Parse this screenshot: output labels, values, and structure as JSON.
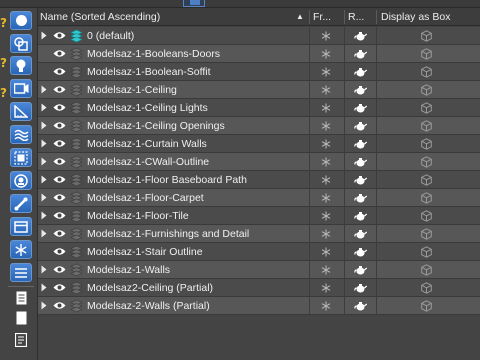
{
  "header": {
    "name_col": "Name (Sorted Ascending)",
    "freeze_col": "Fr...",
    "render_col": "R...",
    "box_col": "Display as Box",
    "sort_arrow": "▲"
  },
  "rows": [
    {
      "name": "0 (default)",
      "expandable": true,
      "highlight": true,
      "alt": false
    },
    {
      "name": "Modelsaz-1-Booleans-Doors",
      "expandable": false,
      "highlight": false,
      "alt": true
    },
    {
      "name": "Modelsaz-1-Boolean-Soffit",
      "expandable": false,
      "highlight": false,
      "alt": false
    },
    {
      "name": "Modelsaz-1-Ceiling",
      "expandable": true,
      "highlight": false,
      "alt": true
    },
    {
      "name": "Modelsaz-1-Ceiling Lights",
      "expandable": true,
      "highlight": false,
      "alt": false
    },
    {
      "name": "Modelsaz-1-Ceiling Openings",
      "expandable": true,
      "highlight": false,
      "alt": true
    },
    {
      "name": "Modelsaz-1-Curtain Walls",
      "expandable": true,
      "highlight": false,
      "alt": false
    },
    {
      "name": "Modelsaz-1-CWall-Outline",
      "expandable": true,
      "highlight": false,
      "alt": true
    },
    {
      "name": "Modelsaz-1-Floor Baseboard Path",
      "expandable": true,
      "highlight": false,
      "alt": false
    },
    {
      "name": "Modelsaz-1-Floor-Carpet",
      "expandable": true,
      "highlight": false,
      "alt": true
    },
    {
      "name": "Modelsaz-1-Floor-Tile",
      "expandable": true,
      "highlight": false,
      "alt": false
    },
    {
      "name": "Modelsaz-1-Furnishings and Detail",
      "expandable": true,
      "highlight": false,
      "alt": true
    },
    {
      "name": "Modelsaz-1-Stair Outline",
      "expandable": false,
      "highlight": false,
      "alt": false
    },
    {
      "name": "Modelsaz-1-Walls",
      "expandable": true,
      "highlight": false,
      "alt": true
    },
    {
      "name": "Modelsaz2-Ceiling (Partial)",
      "expandable": true,
      "highlight": false,
      "alt": false
    },
    {
      "name": "Modelsaz-2-Walls (Partial)",
      "expandable": true,
      "highlight": false,
      "alt": true
    }
  ],
  "sidebar": {
    "buttons": [
      "display-all-icon",
      "display-geometry-icon",
      "display-lights-icon",
      "display-cameras-icon",
      "display-helpers-icon",
      "display-spacewarps-icon",
      "display-groups-icon",
      "display-xrefs-icon",
      "display-bones-icon",
      "display-containers-icon",
      "display-frozen-icon"
    ],
    "plain": [
      "page-icon",
      "blank-page-icon",
      "list-page-icon"
    ]
  },
  "colors": {
    "accent": "#3a78cf",
    "highlight_layer": "#2fc8d0",
    "question": "#e6b92b"
  }
}
